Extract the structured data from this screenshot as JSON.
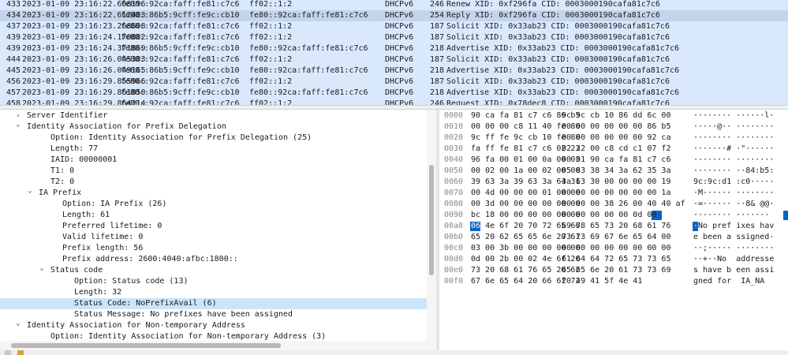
{
  "packet_list": {
    "rows": [
      {
        "no": "433",
        "time": "2023-01-09 23:16:22.608196",
        "src": "fe80::92ca:faff:fe81:c7c6",
        "dst": "ff02::1:2",
        "proto": "DHCPv6",
        "len": "246",
        "info": "Renew XID: 0xf296fa CID: 0003000190cafa81c7c6",
        "selected": false
      },
      {
        "no": "434",
        "time": "2023-01-09 23:16:22.612483",
        "src": "fe80::86b5:9cff:fe9c:cb10",
        "dst": "fe80::92ca:faff:fe81:c7c6",
        "proto": "DHCPv6",
        "len": "254",
        "info": "Reply XID: 0xf296fa CID: 0003000190cafa81c7c6",
        "selected": true
      },
      {
        "no": "437",
        "time": "2023-01-09 23:16:23.268608",
        "src": "fe80::92ca:faff:fe81:c7c6",
        "dst": "ff02::1:2",
        "proto": "DHCPv6",
        "len": "187",
        "info": "Solicit XID: 0x33ab23 CID: 0003000190cafa81c7c6",
        "selected": false
      },
      {
        "no": "439",
        "time": "2023-01-09 23:16:24.170882",
        "src": "fe80::92ca:faff:fe81:c7c6",
        "dst": "ff02::1:2",
        "proto": "DHCPv6",
        "len": "187",
        "info": "Solicit XID: 0x33ab23 CID: 0003000190cafa81c7c6",
        "selected": false
      },
      {
        "no": "439",
        "time": "2023-01-09 23:16:24.371869",
        "src": "fe80::86b5:9cff:fe9c:cb10",
        "dst": "fe80::92ca:faff:fe81:c7c6",
        "proto": "DHCPv6",
        "len": "218",
        "info": "Advertise XID: 0x33ab23 CID: 0003000190cafa81c7c6",
        "selected": false
      },
      {
        "no": "444",
        "time": "2023-01-09 23:16:26.045383",
        "src": "fe80::92ca:faff:fe81:c7c6",
        "dst": "ff02::1:2",
        "proto": "DHCPv6",
        "len": "187",
        "info": "Solicit XID: 0x33ab23 CID: 0003000190cafa81c7c6",
        "selected": false
      },
      {
        "no": "445",
        "time": "2023-01-09 23:16:26.049165",
        "src": "fe80::86b5:9cff:fe9c:cb10",
        "dst": "fe80::92ca:faff:fe81:c7c6",
        "proto": "DHCPv6",
        "len": "218",
        "info": "Advertise XID: 0x33ab23 CID: 0003000190cafa81c7c6",
        "selected": false
      },
      {
        "no": "456",
        "time": "2023-01-09 23:16:29.855966",
        "src": "fe80::92ca:faff:fe81:c7c6",
        "dst": "ff02::1:2",
        "proto": "DHCPv6",
        "len": "187",
        "info": "Solicit XID: 0x33ab23 CID: 0003000190cafa81c7c6",
        "selected": false
      },
      {
        "no": "457",
        "time": "2023-01-09 23:16:29.861850",
        "src": "fe80::86b5:9cff:fe9c:cb10",
        "dst": "fe80::92ca:faff:fe81:c7c6",
        "proto": "DHCPv6",
        "len": "218",
        "info": "Advertise XID: 0x33ab23 CID: 0003000190cafa81c7c6",
        "selected": false
      },
      {
        "no": "458",
        "time": "2023-01-09 23:16:29.864214",
        "src": "fe80::92ca:faff:fe81:c7c6",
        "dst": "ff02::1:2",
        "proto": "DHCPv6",
        "len": "246",
        "info": "Request XID: 0x78dec8 CID: 0003000190cafa81c7c6",
        "selected": false
      }
    ]
  },
  "details": {
    "rows": [
      {
        "indent": 0,
        "arrow": "right",
        "text": "Server Identifier",
        "selected": false
      },
      {
        "indent": 0,
        "arrow": "down",
        "text": "Identity Association for Prefix Delegation",
        "selected": false
      },
      {
        "indent": 1,
        "arrow": "",
        "text": "Option: Identity Association for Prefix Delegation (25)",
        "selected": false
      },
      {
        "indent": 1,
        "arrow": "",
        "text": "Length: 77",
        "selected": false
      },
      {
        "indent": 1,
        "arrow": "",
        "text": "IAID: 00000001",
        "selected": false
      },
      {
        "indent": 1,
        "arrow": "",
        "text": "T1: 0",
        "selected": false
      },
      {
        "indent": 1,
        "arrow": "",
        "text": "T2: 0",
        "selected": false
      },
      {
        "indent": 1,
        "arrow": "down",
        "text": "IA Prefix",
        "selected": false
      },
      {
        "indent": 2,
        "arrow": "",
        "text": "Option: IA Prefix (26)",
        "selected": false
      },
      {
        "indent": 2,
        "arrow": "",
        "text": "Length: 61",
        "selected": false
      },
      {
        "indent": 2,
        "arrow": "",
        "text": "Preferred lifetime: 0",
        "selected": false
      },
      {
        "indent": 2,
        "arrow": "",
        "text": "Valid lifetime: 0",
        "selected": false
      },
      {
        "indent": 2,
        "arrow": "",
        "text": "Prefix length: 56",
        "selected": false
      },
      {
        "indent": 2,
        "arrow": "",
        "text": "Prefix address: 2600:4040:afbc:1800::",
        "selected": false
      },
      {
        "indent": 2,
        "arrow": "down",
        "text": "Status code",
        "selected": false
      },
      {
        "indent": 3,
        "arrow": "",
        "text": "Option: Status code (13)",
        "selected": false
      },
      {
        "indent": 3,
        "arrow": "",
        "text": "Length: 32",
        "selected": false
      },
      {
        "indent": 3,
        "arrow": "",
        "text": "Status Code: NoPrefixAvail (6)",
        "selected": true
      },
      {
        "indent": 3,
        "arrow": "",
        "text": "Status Message: No prefixes have been assigned",
        "selected": false
      },
      {
        "indent": 0,
        "arrow": "down",
        "text": "Identity Association for Non-temporary Address",
        "selected": false
      },
      {
        "indent": 1,
        "arrow": "",
        "text": "Option: Identity Association for Non-temporary Address (3)",
        "selected": false
      }
    ]
  },
  "bytes": {
    "rows": [
      {
        "off": "0000",
        "a": "90 ca fa 81 c7 c6 86 b5",
        "b": "9c 9c cb 10 86 dd 6c 00",
        "asc": "········ ······l·"
      },
      {
        "off": "0010",
        "a": "00 00 00 c8 11 40 fe 80",
        "b": "00 00 00 00 00 00 86 b5",
        "asc": "·····@·· ········"
      },
      {
        "off": "0020",
        "a": "9c ff fe 9c cb 10 fe 80",
        "b": "00 00 00 00 00 00 92 ca",
        "asc": "········ ········"
      },
      {
        "off": "0030",
        "a": "fa ff fe 81 c7 c6 02 23",
        "b": "02 22 00 c8 cd c1 07 f2",
        "asc": "·······# ·\"······"
      },
      {
        "off": "0040",
        "a": "96 fa 00 01 00 0a 00 03",
        "b": "00 01 90 ca fa 81 c7 c6",
        "asc": "········ ········"
      },
      {
        "off": "0050",
        "a": "00 02 00 1a 00 02 00 00",
        "b": "05 83 38 34 3a 62 35 3a",
        "asc": "········ ··84:b5:"
      },
      {
        "off": "0060",
        "a": "39 63 3a 39 63 3a 64 31",
        "b": "3a 63 30 00 00 00 00 19",
        "asc": "9c:9c:d1 :c0·····"
      },
      {
        "off": "0070",
        "a": "00 4d 00 00 00 01 00 00",
        "b": "00 00 00 00 00 00 00 1a",
        "asc": "·M······ ········"
      },
      {
        "off": "0080",
        "a": "00 3d 00 00 00 00 00 00",
        "b": "00 00 00 38 26 00 40 40 af",
        "asc": "·=······ ··8& @@·"
      },
      {
        "off": "0090",
        "a": "bc 18 00 00 00 00 00 00",
        "b": "00 00 00 00 00 0d 00 20",
        "asc": "········ ······· "
      },
      {
        "off": "00a0",
        "a": "06 4e 6f 20 70 72 65 66",
        "b": "69 78 65 73 20 68 61 76",
        "asc": "·No pref ixes hav"
      },
      {
        "off": "00b0",
        "a": "65 20 62 65 65 6e 20 61",
        "b": "73 73 69 67 6e 65 64 00",
        "asc": "e been a ssigned·"
      },
      {
        "off": "00c0",
        "a": "03 00 3b 00 00 00 00 00",
        "b": "00 00 00 00 00 00 00 00",
        "asc": "··;····· ········"
      },
      {
        "off": "00d0",
        "a": "0d 00 2b 00 02 4e 6f 20",
        "b": "61 64 64 72 65 73 73 65",
        "asc": "··+··No  addresse"
      },
      {
        "off": "00e0",
        "a": "73 20 68 61 76 65 20 62",
        "b": "65 65 6e 20 61 73 73 69",
        "asc": "s have b een assi"
      },
      {
        "off": "00f0",
        "a": "67 6e 65 64 20 66 6f 72",
        "b": "20 49 41 5f 4e 41",
        "asc": "gned for  IA_NA"
      }
    ]
  }
}
